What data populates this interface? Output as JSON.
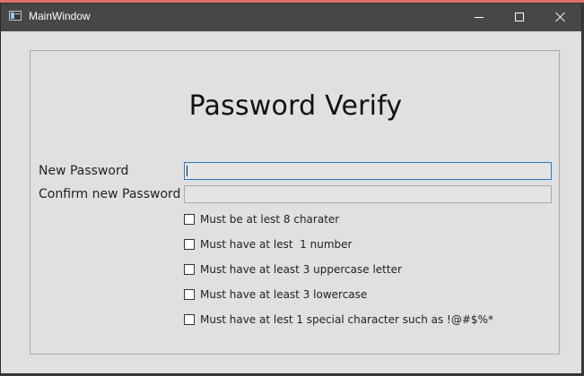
{
  "window": {
    "title": "MainWindow"
  },
  "form": {
    "heading": "Password Verify",
    "new_password_label": "New Password",
    "new_password_value": "",
    "confirm_password_label": "Confirm new Password",
    "confirm_password_value": ""
  },
  "requirements": [
    {
      "label": "Must be at lest 8 charater",
      "checked": false
    },
    {
      "label": "Must have at lest  1 number",
      "checked": false
    },
    {
      "label": "Must have at least 3 uppercase letter",
      "checked": false
    },
    {
      "label": "Must have at least 3 lowercase",
      "checked": false
    },
    {
      "label": "Must have at lest 1 special character such as !@#$%*",
      "checked": false
    }
  ],
  "icons": {
    "app": "app-window-icon",
    "minimize": "minimize-icon",
    "maximize": "maximize-icon",
    "close": "close-icon"
  },
  "colors": {
    "titlebar": "#474747",
    "window_bg": "#e0e0e0",
    "focus_border": "#2a78c8"
  }
}
